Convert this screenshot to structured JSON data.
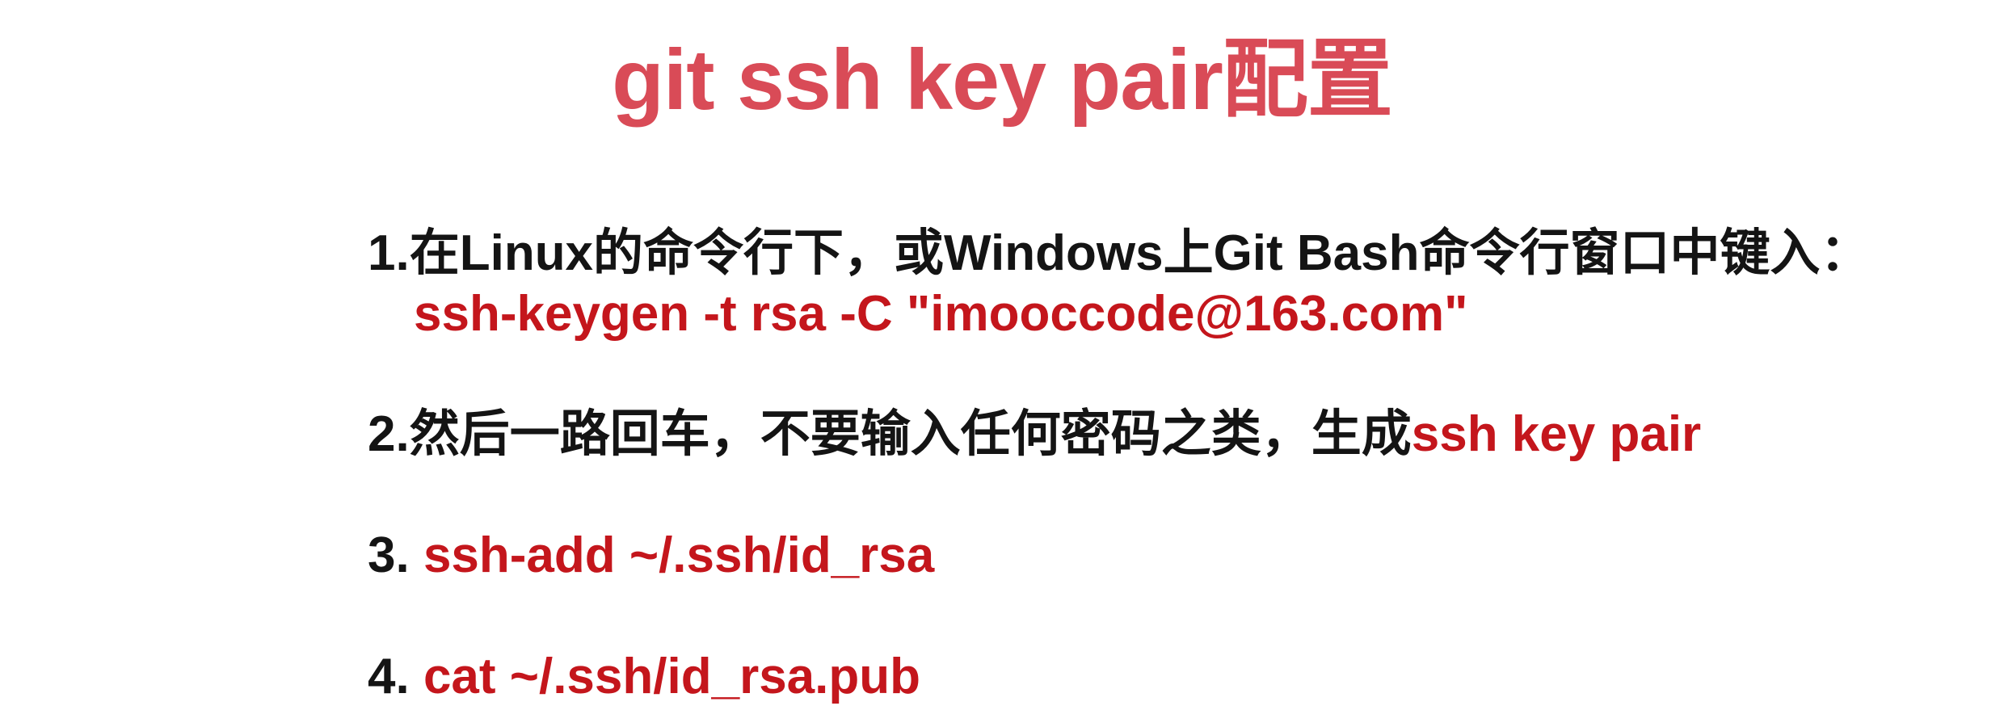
{
  "title": "git ssh key pair配置",
  "steps": [
    {
      "number": "1.",
      "text": "在Linux的命令行下，或Windows上Git Bash命令行窗口中键入：",
      "command": "ssh-keygen -t rsa -C \"imooccode@163.com\""
    },
    {
      "number": "2.",
      "text": "然后一路回车，不要输入任何密码之类，生成",
      "highlight": "ssh key pair"
    },
    {
      "number": "3. ",
      "command": "ssh-add ~/.ssh/id_rsa"
    },
    {
      "number": "4. ",
      "command": "cat ~/.ssh/id_rsa.pub"
    }
  ],
  "colors": {
    "title": "#d94b57",
    "command": "#c4161c",
    "text": "#141414"
  }
}
